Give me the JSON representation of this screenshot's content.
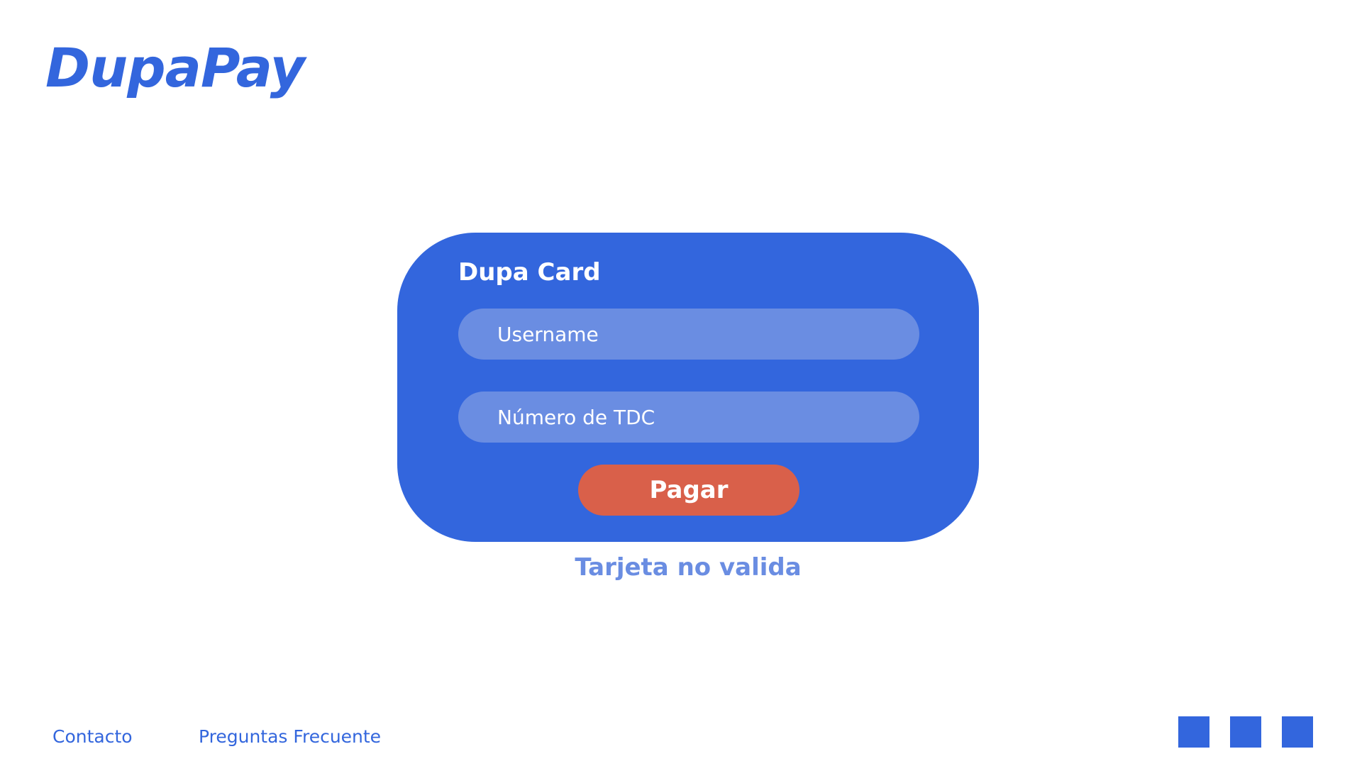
{
  "header": {
    "logo_text": "DupaPay"
  },
  "card": {
    "title": "Dupa Card",
    "username_placeholder": "Username",
    "tdc_placeholder": "Número de TDC",
    "pay_label": "Pagar"
  },
  "status": {
    "error_message": "Tarjeta no valida"
  },
  "footer": {
    "links": [
      {
        "label": "Contacto"
      },
      {
        "label": "Preguntas Frecuente"
      }
    ],
    "social_icons": [
      "social-icon",
      "social-icon",
      "social-icon"
    ]
  },
  "colors": {
    "primary": "#3366dd",
    "field_bg": "#6a8de2",
    "button": "#d9604a",
    "error_text": "#6a8de2",
    "background": "#ffffff"
  }
}
